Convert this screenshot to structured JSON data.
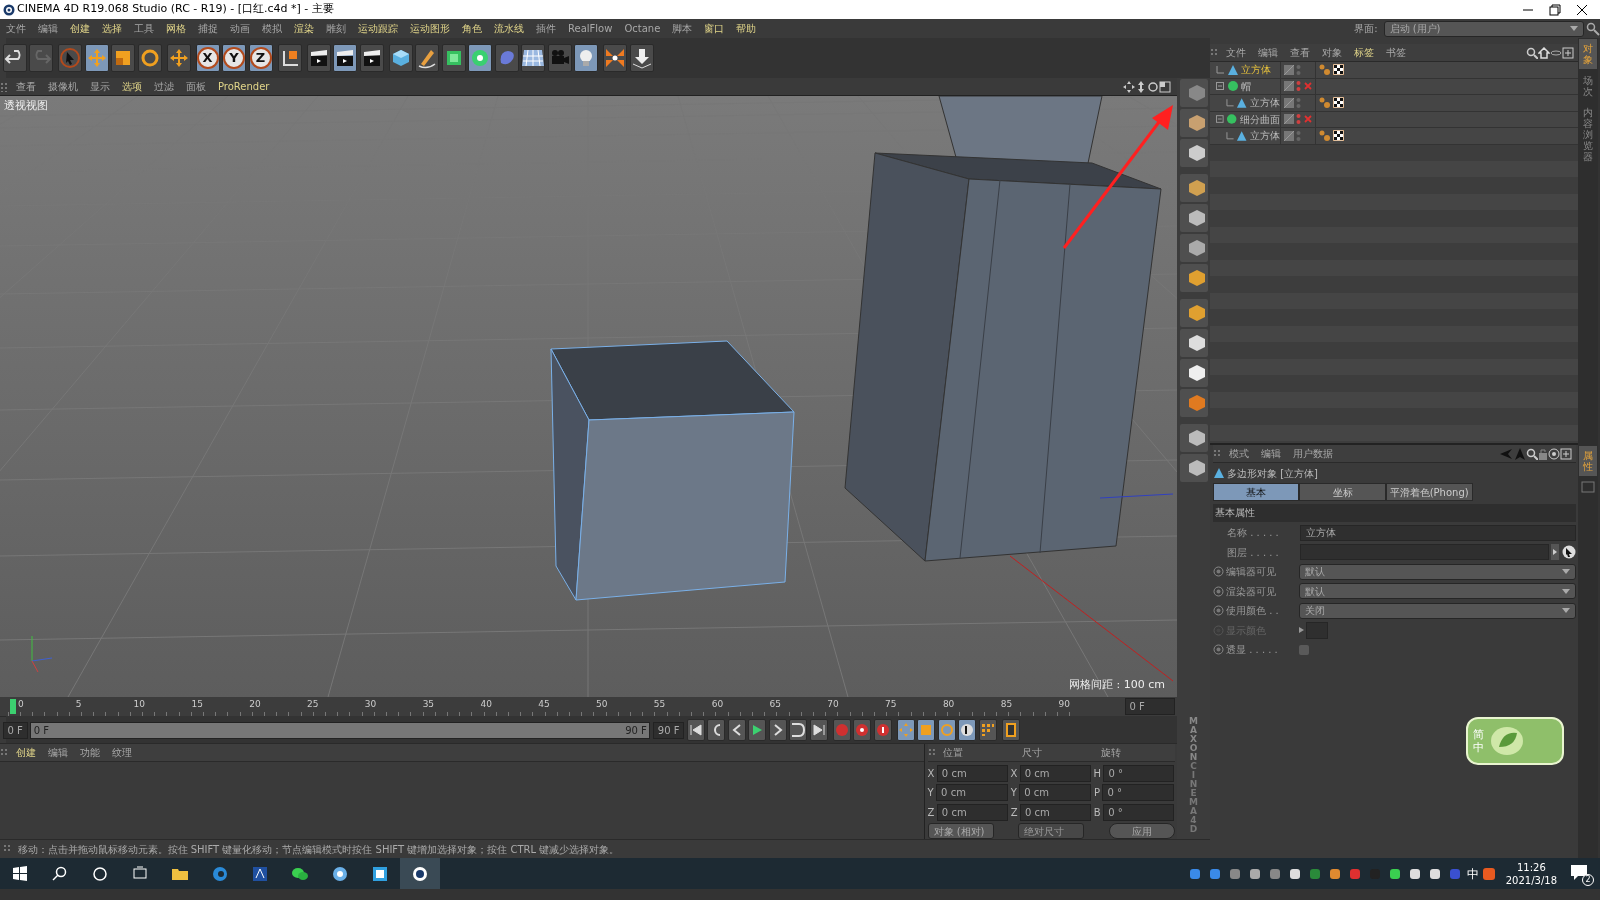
{
  "window": {
    "title": "CINEMA 4D R19.068 Studio (RC - R19) - [口红.c4d *] - 主要"
  },
  "menu": [
    {
      "label": "文件",
      "highlighted": false
    },
    {
      "label": "编辑",
      "highlighted": false
    },
    {
      "label": "创建",
      "highlighted": true
    },
    {
      "label": "选择",
      "highlighted": true
    },
    {
      "label": "工具",
      "highlighted": false
    },
    {
      "label": "网格",
      "highlighted": true
    },
    {
      "label": "捕捉",
      "highlighted": false
    },
    {
      "label": "动画",
      "highlighted": false
    },
    {
      "label": "模拟",
      "highlighted": false
    },
    {
      "label": "渲染",
      "highlighted": true
    },
    {
      "label": "雕刻",
      "highlighted": false
    },
    {
      "label": "运动跟踪",
      "highlighted": true
    },
    {
      "label": "运动图形",
      "highlighted": true
    },
    {
      "label": "角色",
      "highlighted": true
    },
    {
      "label": "流水线",
      "highlighted": true
    },
    {
      "label": "插件",
      "highlighted": false
    },
    {
      "label": "RealFlow",
      "highlighted": false
    },
    {
      "label": "Octane",
      "highlighted": false
    },
    {
      "label": "脚本",
      "highlighted": false
    },
    {
      "label": "窗口",
      "highlighted": true
    },
    {
      "label": "帮助",
      "highlighted": true
    }
  ],
  "interface": {
    "label": "界面:",
    "value": "启动 (用户)"
  },
  "toolbar": [
    {
      "kind": "undo",
      "selected": false
    },
    {
      "kind": "redo",
      "selected": false
    },
    {
      "kind": "select",
      "selected": false
    },
    {
      "kind": "move",
      "selected": true
    },
    {
      "kind": "scale",
      "selected": false
    },
    {
      "kind": "rotate",
      "selected": false
    },
    {
      "kind": "move",
      "selected": false
    },
    {
      "kind": "axis",
      "label": "X",
      "selected": true
    },
    {
      "kind": "axis",
      "label": "Y",
      "selected": true
    },
    {
      "kind": "axis",
      "label": "Z",
      "selected": true
    },
    {
      "kind": "coords",
      "selected": false
    },
    {
      "kind": "clapper",
      "selected": false
    },
    {
      "kind": "clapper",
      "selected": true
    },
    {
      "kind": "clapper",
      "selected": false
    },
    {
      "kind": "cube",
      "selected": false
    },
    {
      "kind": "pen",
      "selected": false
    },
    {
      "kind": "subdiv",
      "selected": false
    },
    {
      "kind": "cloner",
      "selected": true
    },
    {
      "kind": "deformer",
      "selected": false
    },
    {
      "kind": "floor",
      "selected": false
    },
    {
      "kind": "camera",
      "selected": false
    },
    {
      "kind": "light",
      "selected": true
    }
  ],
  "viewport": {
    "menu": [
      {
        "label": "查看",
        "highlighted": false
      },
      {
        "label": "摄像机",
        "highlighted": false
      },
      {
        "label": "显示",
        "highlighted": false
      },
      {
        "label": "选项",
        "highlighted": true
      },
      {
        "label": "过滤",
        "highlighted": false
      },
      {
        "label": "面板",
        "highlighted": false
      },
      {
        "label": "ProRender",
        "highlighted": true
      }
    ],
    "name": "透视视图",
    "grid_spacing": "网格间距 : 100 cm"
  },
  "object_manager": {
    "menu": [
      {
        "label": "文件",
        "highlighted": false
      },
      {
        "label": "编辑",
        "highlighted": false
      },
      {
        "label": "查看",
        "highlighted": false
      },
      {
        "label": "对象",
        "highlighted": false
      },
      {
        "label": "标签",
        "highlighted": true
      },
      {
        "label": "书签",
        "highlighted": false
      }
    ],
    "objects": [
      {
        "name": "立方体",
        "kind": "polygon",
        "selected": true,
        "enabled": true
      },
      {
        "name": "帽",
        "kind": "generator",
        "selected": false,
        "enabled": false,
        "children": [
          {
            "name": "立方体",
            "kind": "polygon",
            "selected": false,
            "enabled": true
          }
        ]
      },
      {
        "name": "细分曲面",
        "kind": "generator",
        "selected": false,
        "enabled": false,
        "children": [
          {
            "name": "立方体",
            "kind": "polygon",
            "selected": false,
            "enabled": true
          }
        ]
      }
    ]
  },
  "side_tabs": [
    {
      "label": "对象",
      "selected": true
    },
    {
      "label": "场次",
      "selected": false
    },
    {
      "label": "内容浏览器",
      "selected": false
    }
  ],
  "attr_side_tabs": [
    {
      "label": "属性",
      "selected": true
    }
  ],
  "attributes": {
    "menu": [
      "模式",
      "编辑",
      "用户数据"
    ],
    "object": "多边形对象 [立方体]",
    "tabs": [
      {
        "label": "基本",
        "selected": true
      },
      {
        "label": "坐标",
        "selected": false
      },
      {
        "label": "平滑着色(Phong)",
        "selected": false
      }
    ],
    "section": "基本属性",
    "fields": [
      {
        "kind": "text",
        "label": "名称 . . . . .",
        "value": "立方体"
      },
      {
        "kind": "link",
        "label": "图层 . . . . ."
      },
      {
        "kind": "select",
        "label": "编辑器可见",
        "value": "默认",
        "disabled": false
      },
      {
        "kind": "select",
        "label": "渲染器可见",
        "value": "默认",
        "disabled": false
      },
      {
        "kind": "select",
        "label": "使用颜色 . .",
        "value": "关闭",
        "disabled": false
      },
      {
        "kind": "color",
        "label": "显示颜色",
        "disabled": true
      },
      {
        "kind": "checkbox",
        "label": "透显 . . . . .",
        "checked": false,
        "disabled": false
      }
    ]
  },
  "timeline": {
    "ticks": [
      "0",
      "5",
      "10",
      "15",
      "20",
      "25",
      "30",
      "35",
      "40",
      "45",
      "50",
      "55",
      "60",
      "65",
      "70",
      "75",
      "80",
      "85",
      "90"
    ],
    "current_frame": "0 F",
    "start": "0 F",
    "range": {
      "start": "0 F",
      "end": "90 F",
      "level": 1
    },
    "end": "90 F"
  },
  "material_manager": {
    "menu": [
      {
        "label": "创建",
        "highlighted": true
      },
      {
        "label": "编辑",
        "highlighted": false
      },
      {
        "label": "功能",
        "highlighted": false
      },
      {
        "label": "纹理",
        "highlighted": false
      }
    ]
  },
  "coordinates": {
    "headers": [
      "位置",
      "尺寸",
      "旋转"
    ],
    "rows": [
      {
        "axis": "X",
        "position": "0 cm",
        "size_axis": "X",
        "size": "0 cm",
        "rotation_axis": "H",
        "rotation": "0 °"
      },
      {
        "axis": "Y",
        "position": "0 cm",
        "size_axis": "Y",
        "size": "0 cm",
        "rotation_axis": "P",
        "rotation": "0 °"
      },
      {
        "axis": "Z",
        "position": "0 cm",
        "size_axis": "Z",
        "size": "0 cm",
        "rotation_axis": "B",
        "rotation": "0 °"
      }
    ],
    "mode": "对象 (相对)",
    "size_mode": "绝对尺寸",
    "apply": "应用"
  },
  "branding": [
    "MAXON",
    "CINEMA 4D"
  ],
  "status_bar": "移动：点击并拖动鼠标移动元素。按住 SHIFT 键量化移动；节点编辑模式时按住 SHIFT 键增加选择对象；按住 CTRL 键减少选择对象。",
  "ime_widget": {
    "mode": "简",
    "lang": "中"
  },
  "taskbar": {
    "ime": "中",
    "time": "11:26",
    "date": "2021/3/18",
    "notifications": "2"
  }
}
